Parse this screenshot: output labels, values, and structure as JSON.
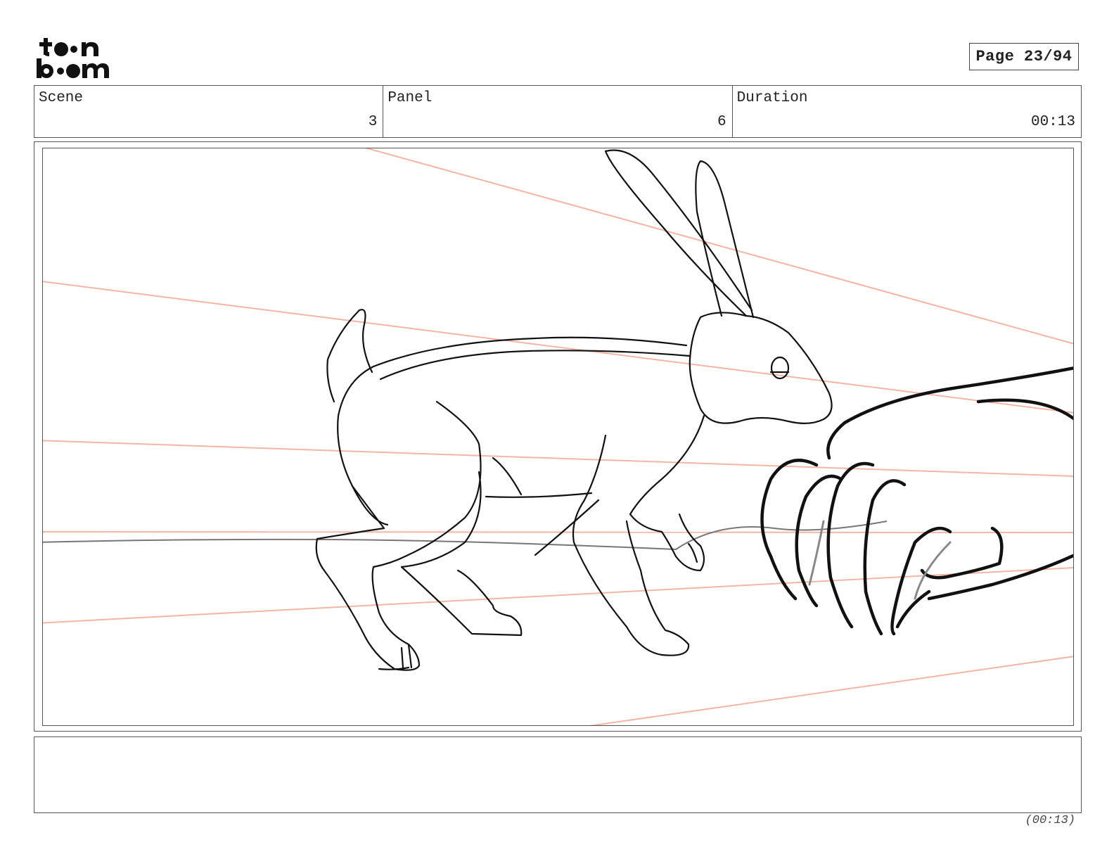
{
  "header": {
    "logo": {
      "icon": "toonboom-logo",
      "line1": "toon",
      "line2": "boom"
    },
    "page_label": "Page 23/94"
  },
  "info": {
    "scene_label": "Scene",
    "scene_value": "3",
    "panel_label": "Panel",
    "panel_value": "6",
    "duration_label": "Duration",
    "duration_value": "00:13"
  },
  "panel": {
    "image": {
      "icon": "rabbit-sketch-with-claw-hand"
    },
    "guide_line_color": "#f2b5a6",
    "sketch_color": "#111111"
  },
  "caption": {
    "text": ""
  },
  "footer": {
    "duration": "(00:13)"
  }
}
